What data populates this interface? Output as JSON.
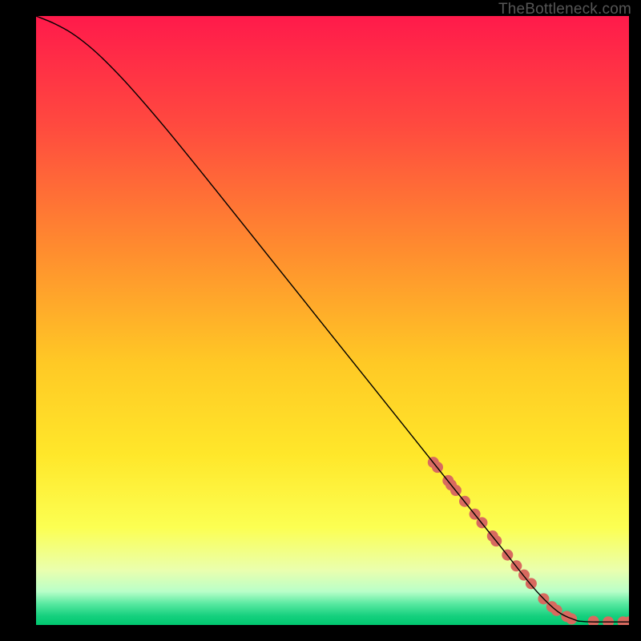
{
  "watermark": "TheBottleneck.com",
  "chart_data": {
    "type": "line",
    "title": "",
    "xlabel": "",
    "ylabel": "",
    "xlim": [
      0,
      100
    ],
    "ylim": [
      0,
      100
    ],
    "grid": false,
    "legend": false,
    "gradient_stops": [
      {
        "offset": 0.0,
        "color": "#ff1a4b"
      },
      {
        "offset": 0.18,
        "color": "#ff4a3f"
      },
      {
        "offset": 0.38,
        "color": "#ff8b2f"
      },
      {
        "offset": 0.57,
        "color": "#ffc925"
      },
      {
        "offset": 0.72,
        "color": "#ffe72a"
      },
      {
        "offset": 0.84,
        "color": "#fcff52"
      },
      {
        "offset": 0.91,
        "color": "#eaffae"
      },
      {
        "offset": 0.945,
        "color": "#b9ffc9"
      },
      {
        "offset": 0.965,
        "color": "#59e9a1"
      },
      {
        "offset": 0.985,
        "color": "#16d07e"
      },
      {
        "offset": 1.0,
        "color": "#00c86f"
      }
    ],
    "series": [
      {
        "name": "curve",
        "type": "line",
        "color": "#000000",
        "width": 1.4,
        "x": [
          0,
          3,
          6,
          9,
          12,
          16,
          22,
          30,
          40,
          50,
          60,
          70,
          78,
          84,
          88,
          91,
          92,
          94,
          96,
          98,
          100
        ],
        "y": [
          100,
          98.8,
          97.2,
          95.0,
          92.3,
          88.2,
          81.4,
          71.8,
          59.6,
          47.4,
          35.2,
          23.0,
          13.3,
          6.0,
          2.2,
          0.8,
          0.6,
          0.5,
          0.5,
          0.5,
          0.5
        ]
      },
      {
        "name": "dots",
        "type": "scatter",
        "color": "#d86a5f",
        "radius": 7,
        "x": [
          67.0,
          67.7,
          69.5,
          70.0,
          70.8,
          72.3,
          74.0,
          75.2,
          77.0,
          77.6,
          79.5,
          81.0,
          82.3,
          83.5,
          85.6,
          87.0,
          87.8,
          89.5,
          90.3,
          94.0,
          96.5,
          99.0,
          100.0
        ],
        "y": [
          26.7,
          25.9,
          23.7,
          23.0,
          22.1,
          20.3,
          18.2,
          16.8,
          14.6,
          13.8,
          11.5,
          9.7,
          8.2,
          6.8,
          4.3,
          3.0,
          2.4,
          1.4,
          1.0,
          0.6,
          0.5,
          0.5,
          0.5
        ]
      }
    ]
  }
}
